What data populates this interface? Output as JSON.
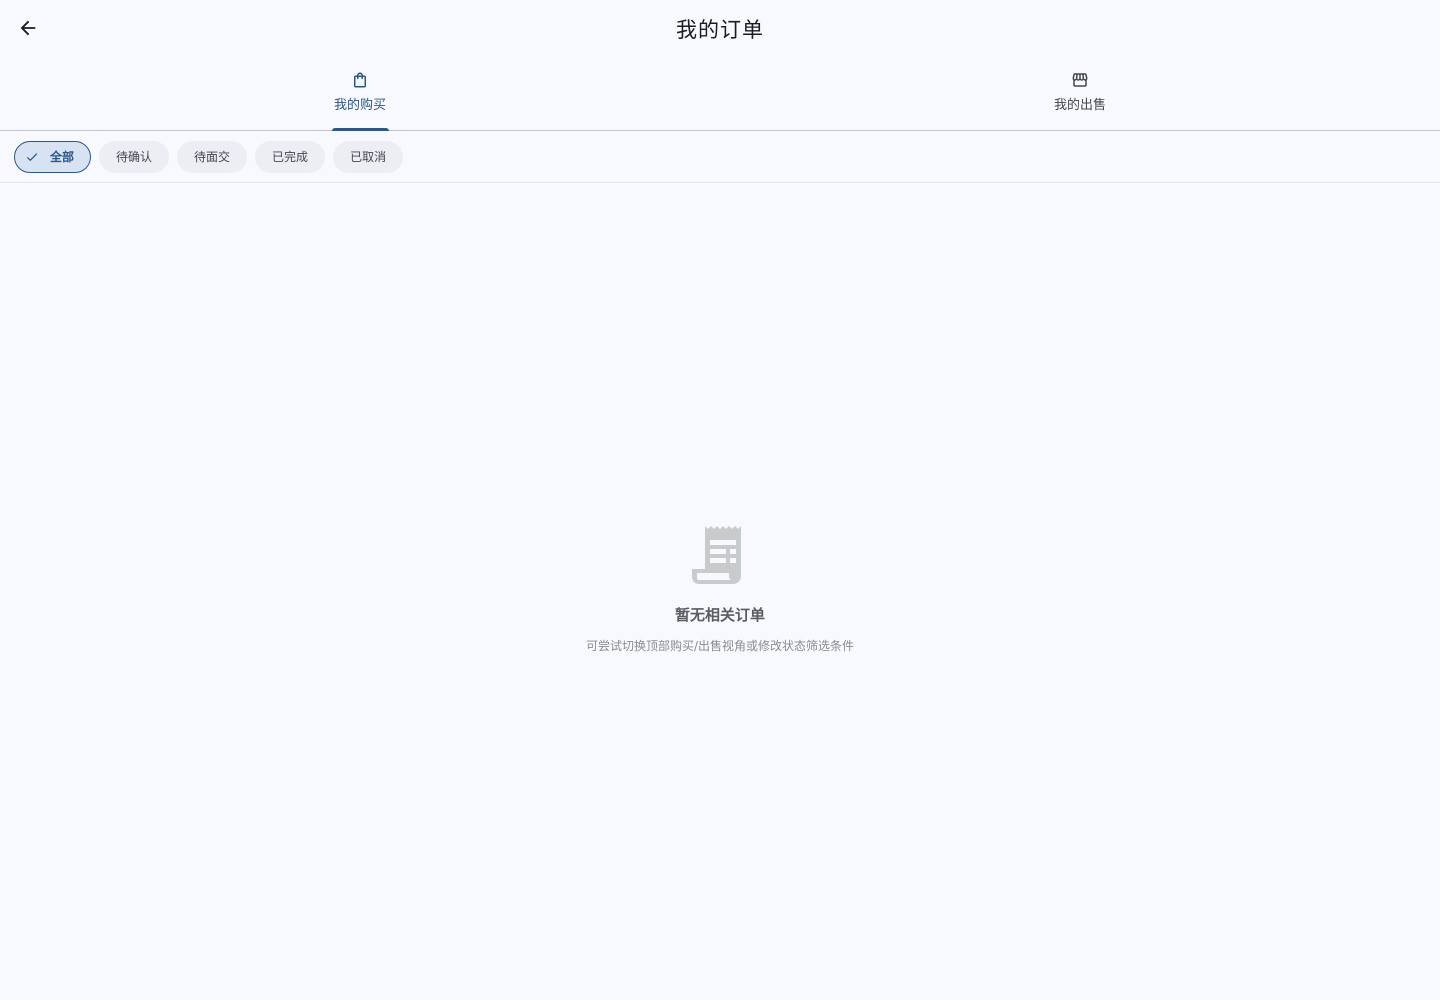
{
  "header": {
    "title": "我的订单",
    "back_icon": "arrow-back-icon"
  },
  "tabs": [
    {
      "label": "我的购买",
      "icon": "shopping-bag-icon",
      "active": true
    },
    {
      "label": "我的出售",
      "icon": "storefront-icon",
      "active": false
    }
  ],
  "filters": [
    {
      "label": "全部",
      "selected": true
    },
    {
      "label": "待确认",
      "selected": false
    },
    {
      "label": "待面交",
      "selected": false
    },
    {
      "label": "已完成",
      "selected": false
    },
    {
      "label": "已取消",
      "selected": false
    }
  ],
  "empty_state": {
    "icon": "receipt-icon",
    "title": "暂无相关订单",
    "subtitle": "可尝试切换顶部购买/出售视角或修改状态筛选条件"
  },
  "colors": {
    "accent": "#2e5686",
    "background": "#f7f9fe",
    "chip_bg": "#eceef4",
    "chip_selected_bg": "#d7e2f3",
    "empty_icon": "#c9cacc"
  }
}
